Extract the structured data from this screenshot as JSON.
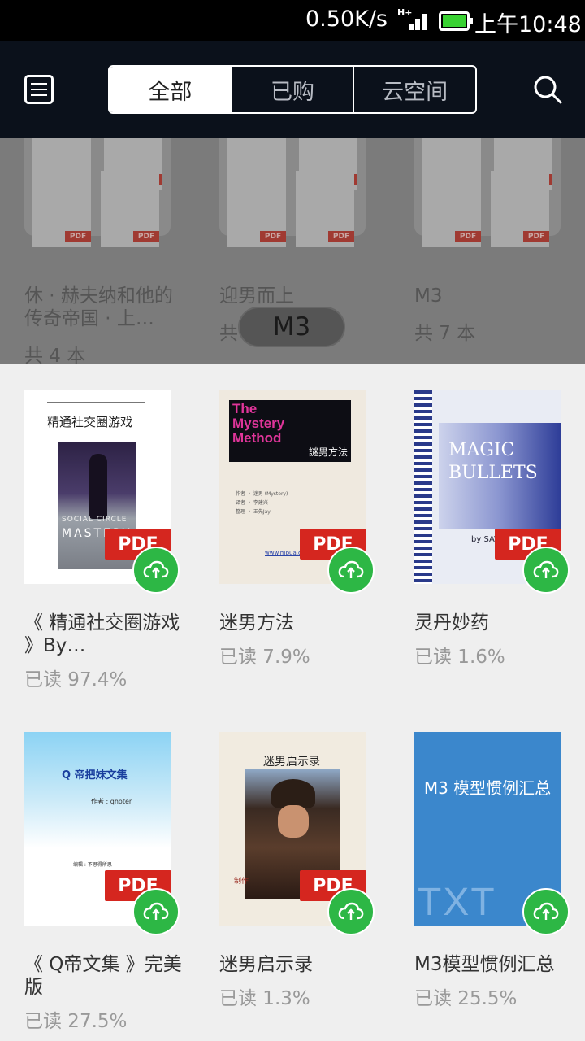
{
  "status_bar": {
    "speed": "0.50K/s",
    "network": "H+",
    "time": "上午10:48"
  },
  "header": {
    "tabs": [
      "全部",
      "已购",
      "云空间"
    ],
    "active_tab": "全部"
  },
  "folders": [
    {
      "name": "休 · 赫夫纳和他的传奇帝国 · 上…",
      "count": "共 4 本"
    },
    {
      "name": "迎男而上",
      "count": "共 5 本"
    },
    {
      "name": "M3",
      "count": "共 7 本"
    }
  ],
  "current_folder_badge": "M3",
  "books": [
    {
      "title": "《 精通社交圈游戏 》By…",
      "progress": "已读 97.4%",
      "format": "PDF",
      "cover_text": [
        "精通社交圈游戏",
        "SOCIAL CIRCLE MASTERY",
        "SOCIAL CIRCLE",
        "MASTERY"
      ]
    },
    {
      "title": "迷男方法",
      "progress": "已读 7.9%",
      "format": "PDF",
      "cover_text": [
        "The",
        "Mystery",
        "Method",
        "謎男方法",
        "作者 ・ 迷男 (Mystery)",
        "译者 ・ 李建兴",
        "整理 ・ 王先Jay",
        "www.mpua.org"
      ]
    },
    {
      "title": "灵丹妙药",
      "progress": "已读 1.6%",
      "format": "PDF",
      "cover_text": [
        "MAGIC",
        "BULLETS",
        "by SAV"
      ]
    },
    {
      "title": "《 Q帝文集 》完美版",
      "progress": "已读 27.5%",
      "format": "PDF",
      "cover_text": [
        "Q 帝把妹文集",
        "作者 : qhoter",
        "编辑 : 不思得所思"
      ]
    },
    {
      "title": "迷男启示录",
      "progress": "已读 1.3%",
      "format": "PDF",
      "cover_text": [
        "迷男启示录",
        "制作"
      ]
    },
    {
      "title": "M3模型惯例汇总",
      "progress": "已读 25.5%",
      "format": "TXT",
      "cover_text": [
        "M3 模型惯例汇总",
        "TXT"
      ]
    }
  ],
  "colors": {
    "header_bg": "#0b111b",
    "pdf_badge": "#d5261f",
    "cloud_button": "#2db745",
    "txt_cover": "#3b87cc"
  },
  "icons": [
    "menu-icon",
    "search-icon",
    "cloud-upload-icon",
    "battery-icon",
    "signal-icon"
  ]
}
